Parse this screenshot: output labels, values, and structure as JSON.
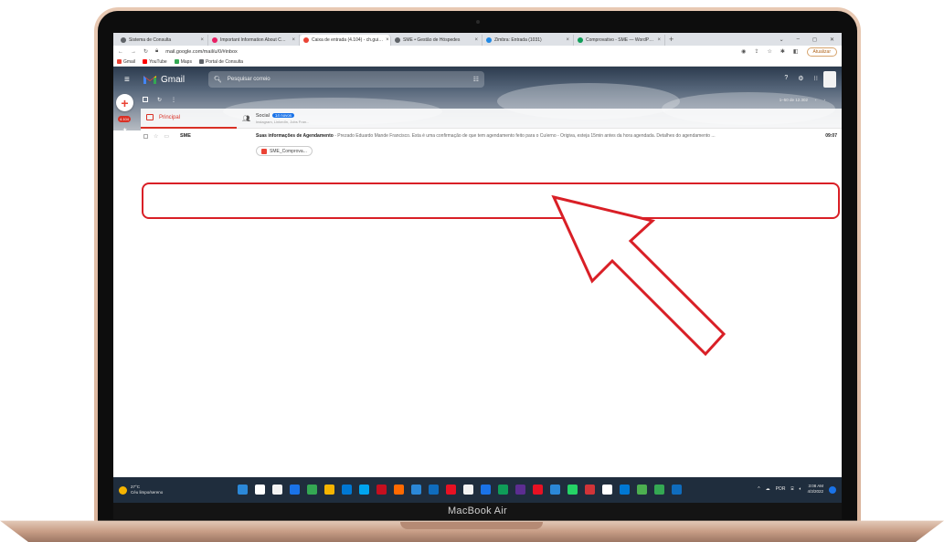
{
  "browser": {
    "tabs": [
      {
        "label": "Sistema de Consulta",
        "color": "#5f6368"
      },
      {
        "label": "Important Information About C…",
        "color": "#e91e63"
      },
      {
        "label": "Caixa de entrada (4.104) - ch.gui…",
        "color": "#ea4335"
      },
      {
        "label": "SME • Gestão de Hóspedes",
        "color": "#5f6368"
      },
      {
        "label": "Zimbra: Entrada (1031)",
        "color": "#1e88e5"
      },
      {
        "label": "Comprovativo - SME — WordP…",
        "color": "#0f9d58"
      }
    ],
    "active_tab_index": 2,
    "url": "mail.google.com/mail/u/0/#inbox",
    "profile_button": "Atualizar",
    "bookmarks": [
      {
        "label": "Gmail",
        "color": "#ea4335"
      },
      {
        "label": "YouTube",
        "color": "#ff0000"
      },
      {
        "label": "Maps",
        "color": "#34a853"
      },
      {
        "label": "Portal de Consulta",
        "color": "#5f6368"
      }
    ]
  },
  "gmail": {
    "app_name": "Gmail",
    "search_placeholder": "Pesquisar correio",
    "unread_badge": "4.104",
    "pager": "1–50 de 12.302",
    "categories": {
      "primary": "Principal",
      "social": "Social",
      "social_new": "14 novos",
      "social_sub": "Instagram, LinkedIn, Jobs Fran..."
    },
    "email": {
      "sender": "SME",
      "subject": "Suas informações de Agendamento",
      "preview": " - Prezado Eduardo Mande Francisco. Esta é uma confirmação de que tem agendamento feito para o Cuíerno - Origiva, esteja 15min antes da hora agendada. Detalhes do agendamento ...",
      "time": "09:07",
      "attachment": "SME_Comprova..."
    }
  },
  "taskbar": {
    "temperature": "27°C",
    "weather_desc": "Céu limpo/sereno",
    "language": "POR",
    "time": "3:08 AM",
    "date": "4/3/2022",
    "apps": [
      "#2b88d8",
      "#ffffff",
      "#f2f2f2",
      "#1a73e8",
      "#34a853",
      "#f5b400",
      "#0078d4",
      "#00a4ef",
      "#c50f1f",
      "#ff6a00",
      "#2b88d8",
      "#0f6cbd",
      "#e81123",
      "#f2f2f2",
      "#1a73e8",
      "#0f9d58",
      "#5c2d91",
      "#e81123",
      "#2b88d8",
      "#25d366",
      "#d13438",
      "#ffffff",
      "#0078d4",
      "#4caf50",
      "#34a853",
      "#0f6cbd"
    ]
  },
  "device_label": "MacBook Air",
  "annotation_color": "#d91f26"
}
